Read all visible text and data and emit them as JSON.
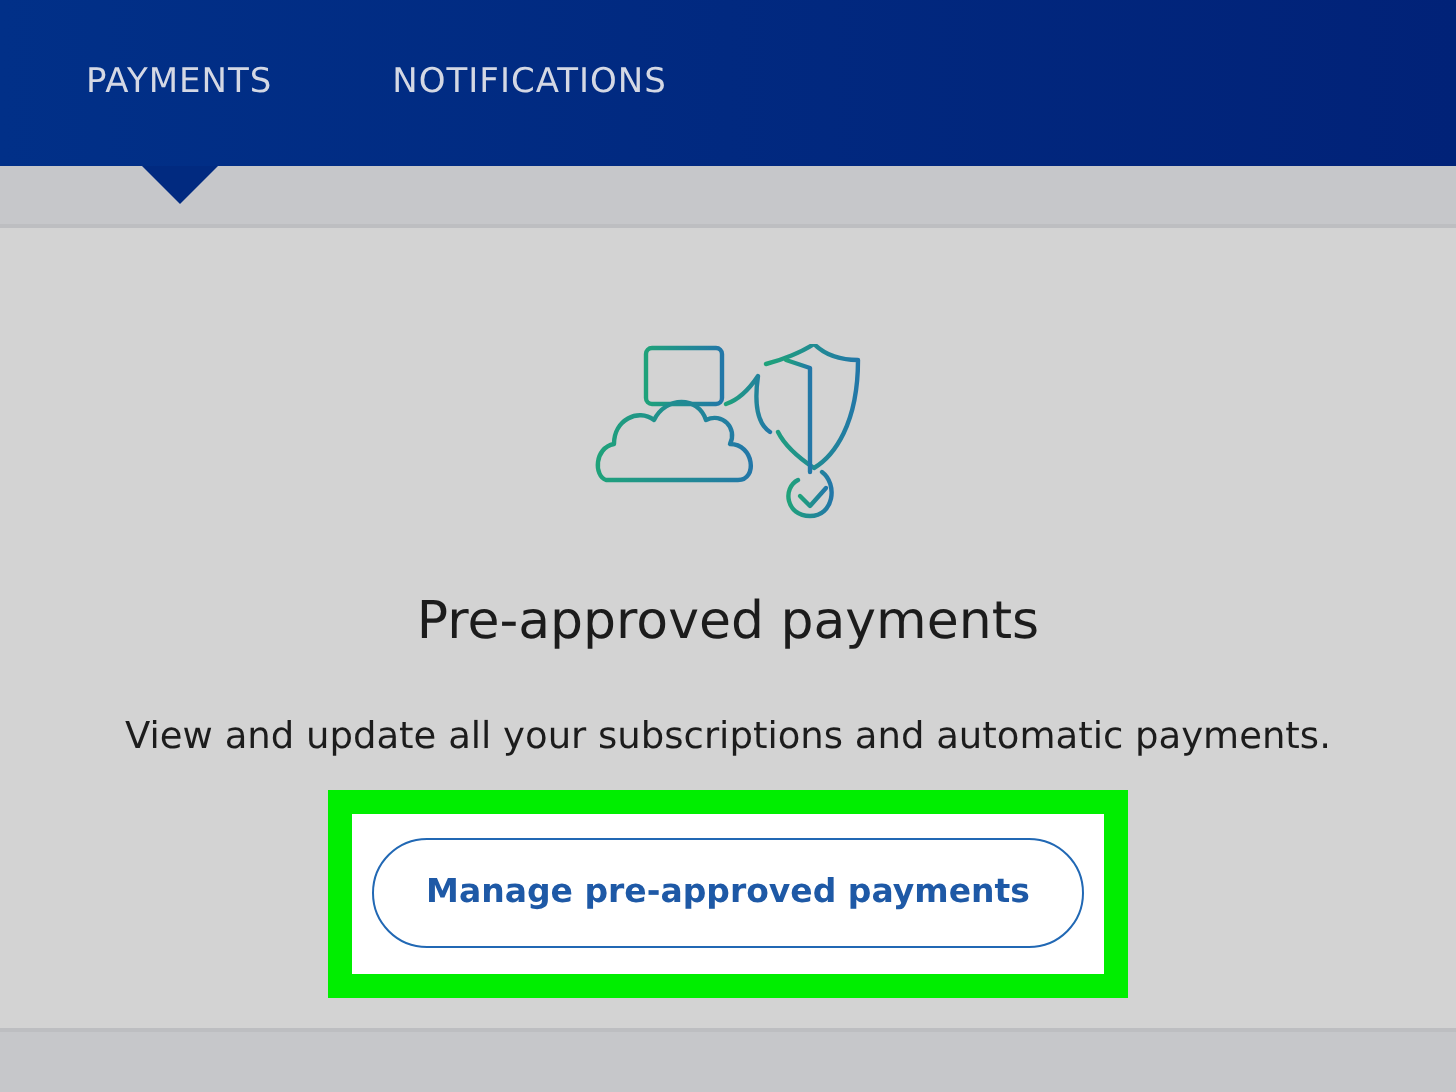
{
  "tabs": [
    {
      "label": "PAYMENTS",
      "selected": true
    },
    {
      "label": "NOTIFICATIONS",
      "selected": false
    }
  ],
  "panel": {
    "title": "Pre-approved payments",
    "description": "View and update all your subscriptions and automatic payments.",
    "button": {
      "label": "Manage pre-approved payments",
      "highlighted": true
    }
  }
}
